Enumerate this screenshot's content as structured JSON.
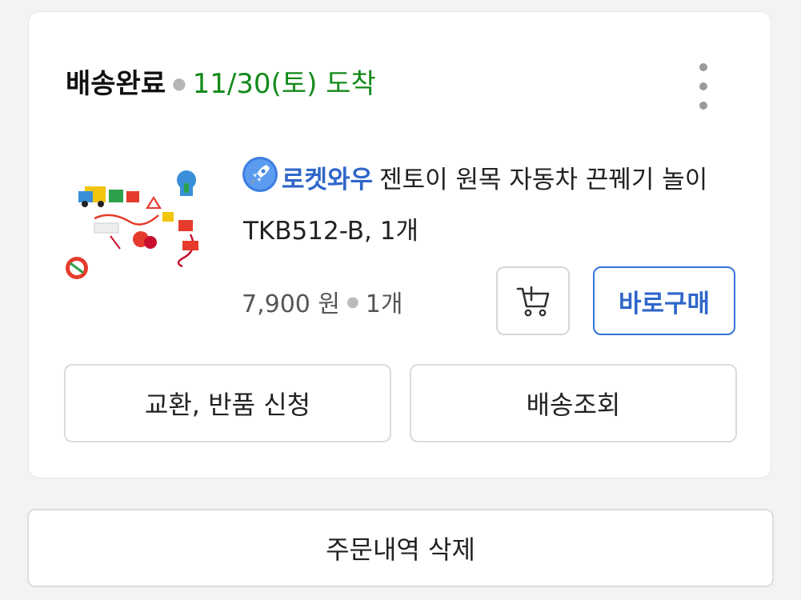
{
  "order": {
    "status": "배송완료",
    "arrival": "11/30(토) 도착",
    "more_icon": "vertical-dots-icon",
    "product": {
      "brand": "로켓와우",
      "brand_icon": "rocket-icon",
      "name": "젠토이 원목 자동차 끈꿰기 놀이 TKB512-B, 1개",
      "price": "7,900 원",
      "quantity": "1개"
    },
    "cart_icon": "add-to-cart-icon",
    "buy_now_label": "바로구매",
    "exchange_return_label": "교환, 반품 신청",
    "track_delivery_label": "배송조회"
  },
  "delete_order_label": "주문내역 삭제",
  "colors": {
    "status_green": "#138a1a",
    "brand_blue": "#2f66c9",
    "background": "#f3f3f3"
  }
}
